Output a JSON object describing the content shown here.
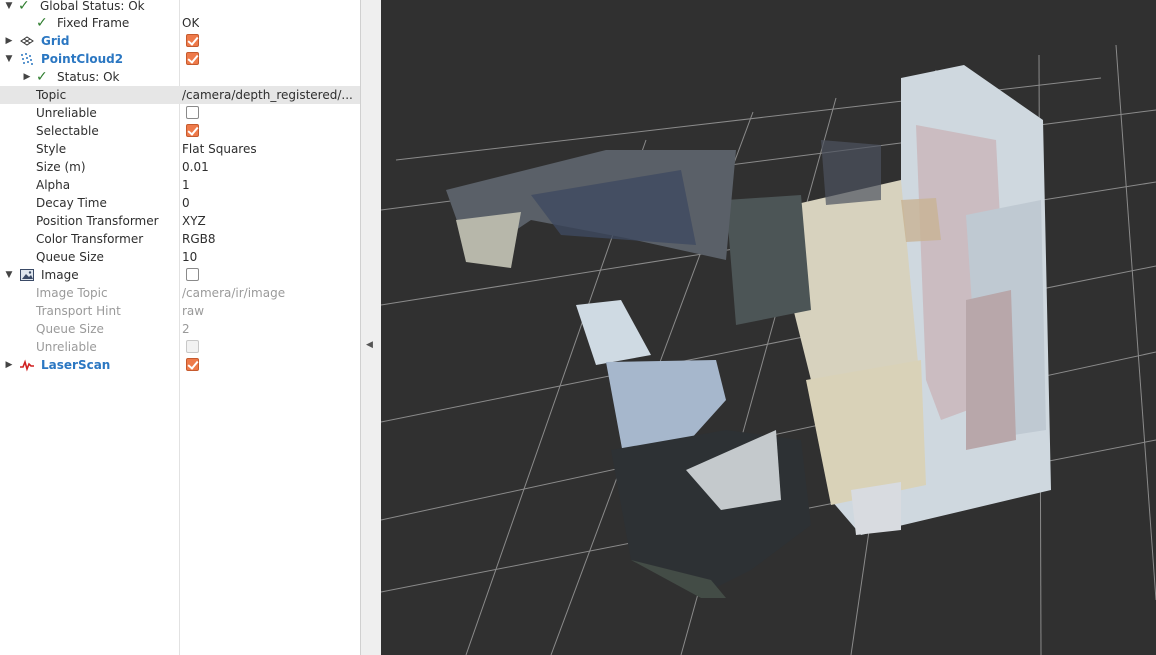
{
  "tree": {
    "global_status": {
      "label": "Global Status: Ok"
    },
    "fixed_frame": {
      "label": "Fixed Frame",
      "value": "OK"
    },
    "grid": {
      "label": "Grid",
      "enabled": true
    },
    "pointcloud2": {
      "label": "PointCloud2",
      "enabled": true,
      "status": "Status: Ok",
      "properties": [
        {
          "label": "Topic",
          "value": "/camera/depth_registered/..."
        },
        {
          "label": "Unreliable",
          "checked": false
        },
        {
          "label": "Selectable",
          "checked": true
        },
        {
          "label": "Style",
          "value": "Flat Squares"
        },
        {
          "label": "Size (m)",
          "value": "0.01"
        },
        {
          "label": "Alpha",
          "value": "1"
        },
        {
          "label": "Decay Time",
          "value": "0"
        },
        {
          "label": "Position Transformer",
          "value": "XYZ"
        },
        {
          "label": "Color Transformer",
          "value": "RGB8"
        },
        {
          "label": "Queue Size",
          "value": "10"
        }
      ]
    },
    "image": {
      "label": "Image",
      "enabled": false,
      "properties": [
        {
          "label": "Image Topic",
          "value": "/camera/ir/image"
        },
        {
          "label": "Transport Hint",
          "value": "raw"
        },
        {
          "label": "Queue Size",
          "value": "2"
        },
        {
          "label": "Unreliable",
          "checked": false
        }
      ]
    },
    "laserscan": {
      "label": "LaserScan",
      "enabled": true
    }
  },
  "icons": {
    "status_ok": "checkmark-icon",
    "grid": "grid-icon",
    "pointcloud": "pointcloud-icon",
    "image": "image-icon",
    "laserscan": "laserscan-icon",
    "expand": "triangle-right-icon",
    "collapse": "triangle-down-icon",
    "splitter": "triangle-left-icon"
  },
  "colors": {
    "display_name": "#2b77c2",
    "checkbox": "#ee7a4a",
    "viewport_bg": "#303030",
    "grid_line": "#8a8a8a"
  }
}
